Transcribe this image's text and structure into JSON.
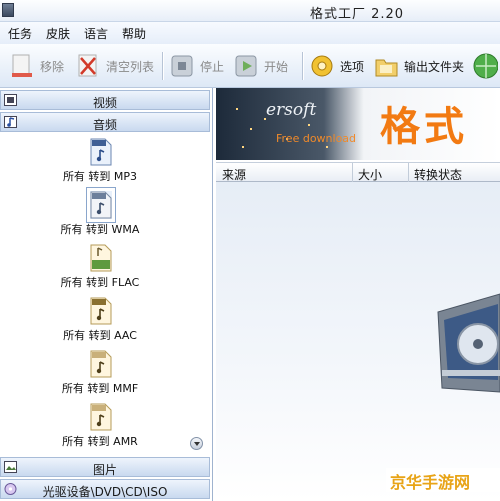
{
  "window": {
    "title": "格式工厂 2.20"
  },
  "menu": {
    "items": [
      "任务",
      "皮肤",
      "语言",
      "帮助"
    ]
  },
  "toolbar": {
    "remove": "移除",
    "clear": "清空列表",
    "stop": "停止",
    "start": "开始",
    "options": "选项",
    "output_folder": "输出文件夹"
  },
  "sidebar": {
    "categories": {
      "video": "视频",
      "audio": "音频",
      "image": "图片",
      "rom": "光驱设备\\DVD\\CD\\ISO"
    },
    "formats": [
      {
        "icon": "MP3",
        "label": "所有 转到 MP3"
      },
      {
        "icon": "WMA",
        "label": "所有 转到 WMA"
      },
      {
        "icon": "fla",
        "label": "所有 转到 FLAC"
      },
      {
        "icon": "AAC",
        "label": "所有 转到 AAC"
      },
      {
        "icon": "MMF",
        "label": "所有 转到 MMF"
      },
      {
        "icon": "AMR",
        "label": "所有 转到 AMR"
      }
    ]
  },
  "banner": {
    "brand": "ersoft",
    "subtitle": "Free download",
    "title": "格式工"
  },
  "list": {
    "columns": {
      "source": "来源",
      "size": "大小",
      "status": "转换状态"
    }
  },
  "watermark": "京华手游网",
  "colors": {
    "accent": "#f27a12",
    "panel": "#c9d9ef",
    "watermark": "#e8a417"
  }
}
